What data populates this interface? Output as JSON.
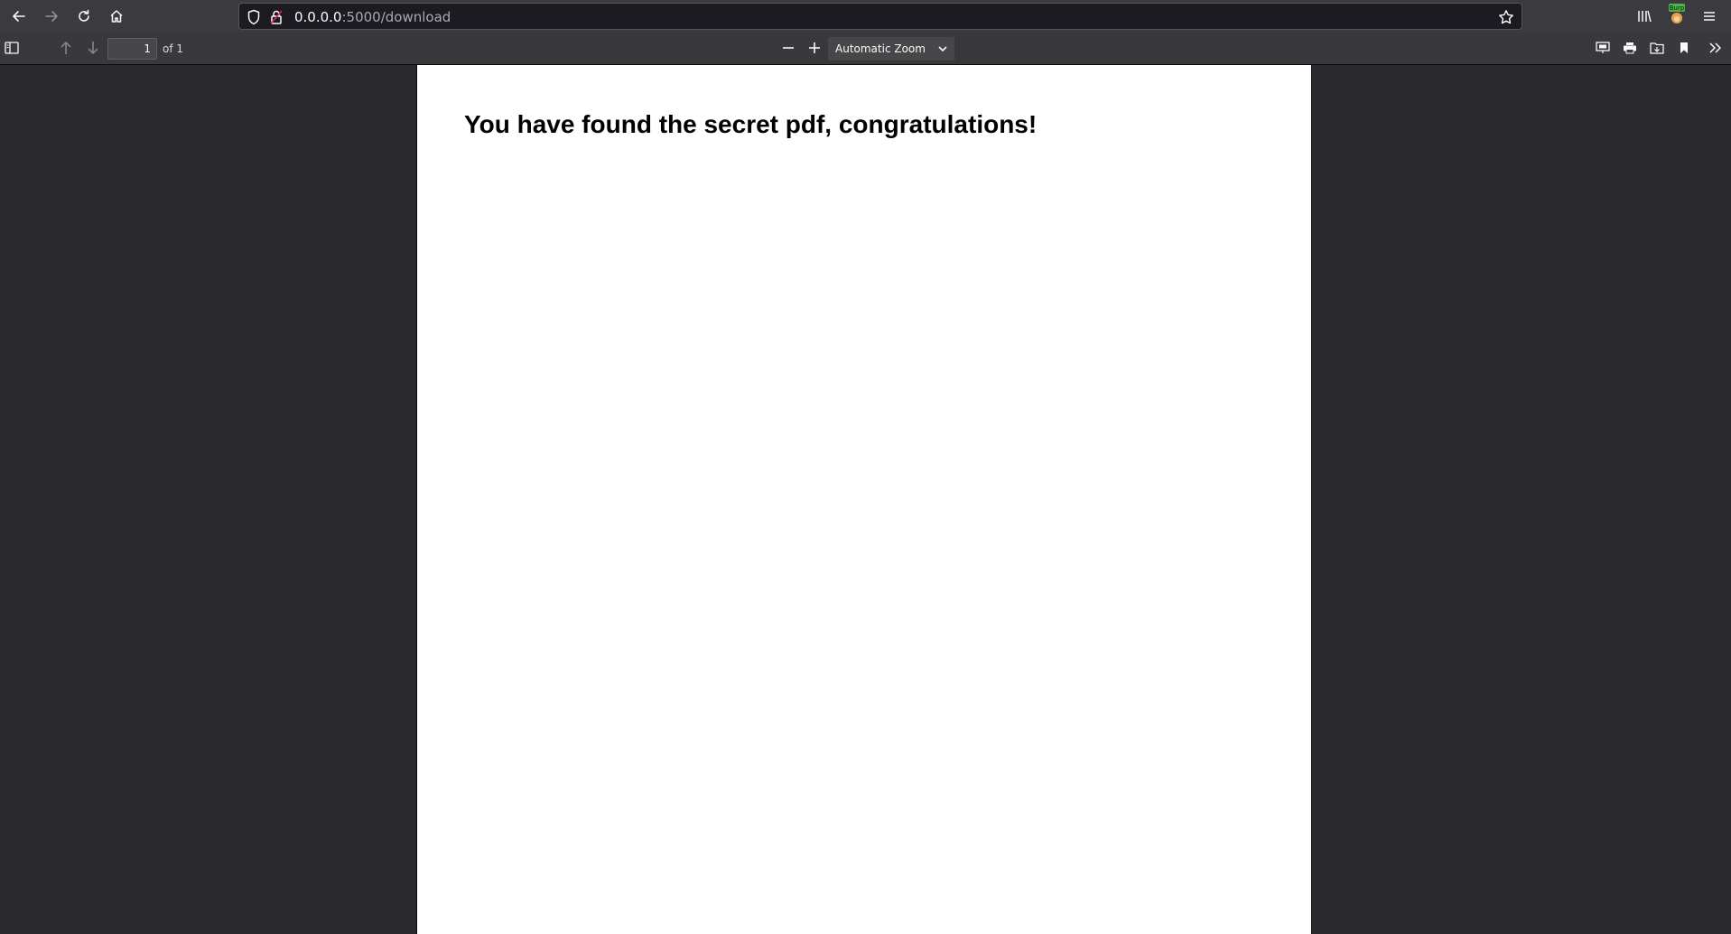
{
  "browser": {
    "url_host": "0.0.0.0",
    "url_path": ":5000/download",
    "extension_badge": "Burp"
  },
  "icons": {
    "back": "arrow-left-icon",
    "forward": "arrow-right-icon",
    "reload": "reload-icon",
    "home": "home-icon",
    "shield": "shield-icon",
    "lock": "lock-icon",
    "bookmark_star": "star-icon",
    "library": "library-icon",
    "menu": "hamburger-menu-icon"
  },
  "pdf_toolbar": {
    "page_number": "1",
    "page_count": "of 1",
    "zoom": "Automatic Zoom"
  },
  "document": {
    "heading": "You have found the secret pdf, congratulations!"
  },
  "colors": {
    "toolbar": "#3b3b3f",
    "pdf_toolbar": "#38383d",
    "viewer_bg": "#2a2a2e",
    "page": "#ffffff"
  }
}
